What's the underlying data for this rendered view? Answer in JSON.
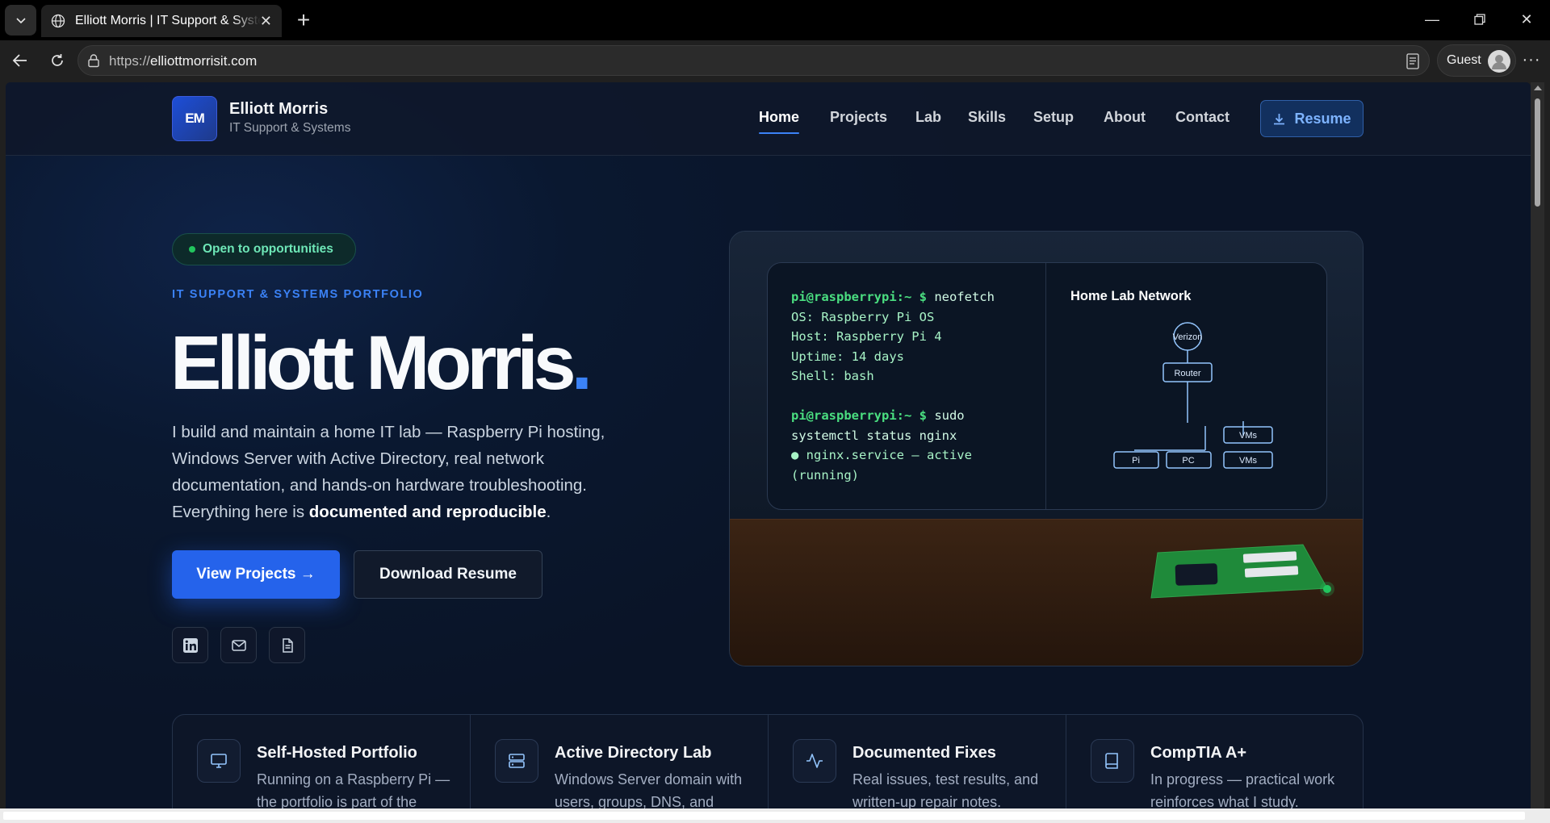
{
  "browser": {
    "tab_title": "Elliott Morris | IT Support & Systems",
    "url_proto": "https://",
    "url_host": "elliottmorrisit.com",
    "profile_label": "Guest"
  },
  "header": {
    "logo_text": "EM",
    "brand_name": "Elliott Morris",
    "brand_sub": "IT Support & Systems",
    "nav": [
      "Home",
      "Projects",
      "Lab",
      "Skills",
      "Setup",
      "About",
      "Contact"
    ],
    "active_nav": "Home",
    "resume_label": "Resume"
  },
  "hero": {
    "status_pill": "Open to opportunities",
    "eyebrow": "IT SUPPORT & SYSTEMS PORTFOLIO",
    "title": "Elliott Morris",
    "title_dot": ".",
    "lead_1": "I build and maintain a home IT lab — Raspberry Pi hosting, Windows Server with Active Directory, real network documentation, and hands-on hardware troubleshooting. Everything here is ",
    "lead_bold": "documented and reproducible",
    "lead_2": ".",
    "primary_button": "View Projects →",
    "secondary_button": "Download Resume"
  },
  "terminal": {
    "prompt": "pi@raspberrypi:~ $",
    "cmd1": " neofetch",
    "lines1": [
      "OS: Raspberry Pi OS",
      "Host: Raspberry Pi 4",
      "Uptime: 14 days",
      "Shell: bash"
    ],
    "cmd2a": " sudo",
    "cmd2b": "systemctl status nginx",
    "status_a": "● nginx.service – active",
    "status_b": "(running)"
  },
  "network": {
    "title": "Home Lab Network",
    "nodes": {
      "isp": "Verizon",
      "router": "Router",
      "pi": "Pi",
      "pc": "PC",
      "vms_top": "VMs",
      "vms_bottom": "VMs"
    }
  },
  "features": [
    {
      "icon": "monitor-icon",
      "title": "Self-Hosted Portfolio",
      "desc": "Running on a Raspberry Pi — the portfolio is part of the"
    },
    {
      "icon": "server-icon",
      "title": "Active Directory Lab",
      "desc": "Windows Server domain with users, groups, DNS, and"
    },
    {
      "icon": "activity-icon",
      "title": "Documented Fixes",
      "desc": "Real issues, test results, and written-up repair notes."
    },
    {
      "icon": "book-icon",
      "title": "CompTIA A+",
      "desc": "In progress — practical work reinforces what I study."
    }
  ],
  "colors": {
    "accent": "#3b82f6",
    "primary_button": "#2563eb",
    "terminal_green": "#4ade80",
    "status_green": "#22c55e"
  }
}
